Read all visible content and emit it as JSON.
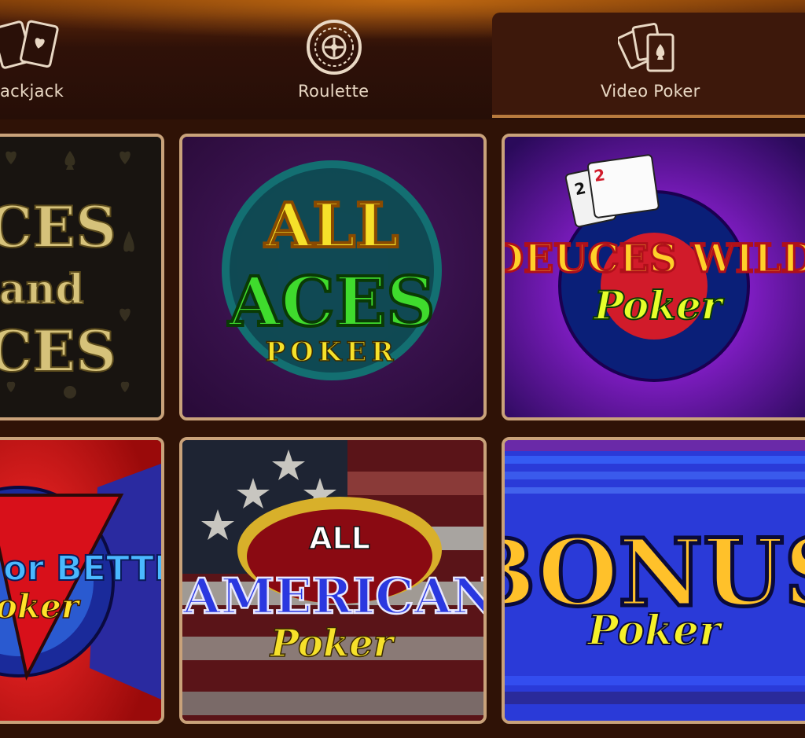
{
  "tabs": [
    {
      "label": "ackjack",
      "icon": "cards-icon",
      "active": false
    },
    {
      "label": "Roulette",
      "icon": "roulette-wheel-icon",
      "active": false
    },
    {
      "label": "Video Poker",
      "icon": "poker-cards-icon",
      "active": true
    }
  ],
  "games": [
    {
      "name_lines": [
        "CES",
        "and",
        "CES"
      ],
      "theme": "dark-damask"
    },
    {
      "name_lines": [
        "ALL",
        "ACES",
        "POKER"
      ],
      "theme": "purple"
    },
    {
      "name_lines": [
        "DEUCES WILD",
        "Poker"
      ],
      "card_ranks": [
        "2",
        "2"
      ],
      "theme": "burst"
    },
    {
      "name_lines": [
        "or BETTER",
        "oker"
      ],
      "theme": "red-blue"
    },
    {
      "name_lines": [
        "ALL",
        "AMERICAN",
        "Poker"
      ],
      "theme": "flag"
    },
    {
      "name_lines": [
        "BONUS",
        "Poker"
      ],
      "theme": "blue-stripes"
    }
  ],
  "colors": {
    "header_bg": "#260e07",
    "active_tab_bg": "#3d180b",
    "card_border": "#c9a27a",
    "tab_text": "#e9d8c4"
  }
}
